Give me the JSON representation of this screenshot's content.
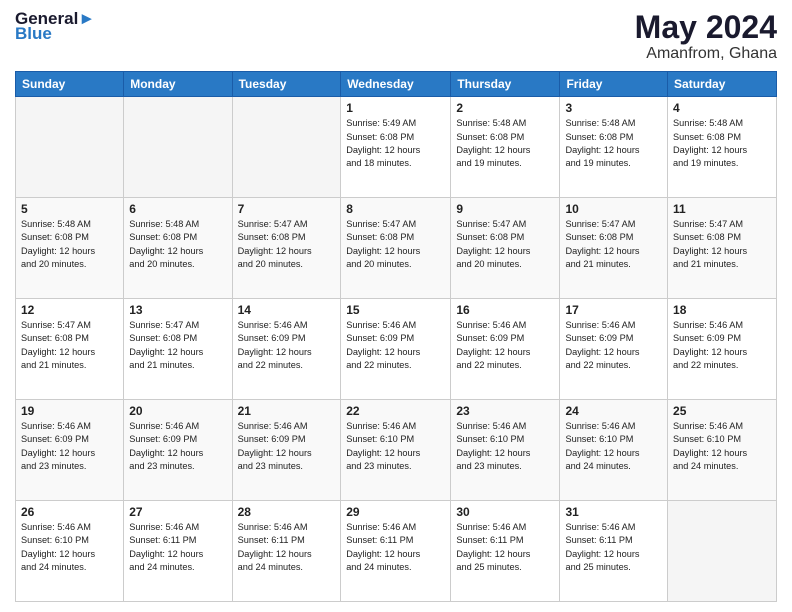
{
  "header": {
    "logo_line1": "General",
    "logo_line2": "Blue",
    "month": "May 2024",
    "location": "Amanfrom, Ghana"
  },
  "weekdays": [
    "Sunday",
    "Monday",
    "Tuesday",
    "Wednesday",
    "Thursday",
    "Friday",
    "Saturday"
  ],
  "weeks": [
    [
      {
        "day": "",
        "info": ""
      },
      {
        "day": "",
        "info": ""
      },
      {
        "day": "",
        "info": ""
      },
      {
        "day": "1",
        "info": "Sunrise: 5:49 AM\nSunset: 6:08 PM\nDaylight: 12 hours\nand 18 minutes."
      },
      {
        "day": "2",
        "info": "Sunrise: 5:48 AM\nSunset: 6:08 PM\nDaylight: 12 hours\nand 19 minutes."
      },
      {
        "day": "3",
        "info": "Sunrise: 5:48 AM\nSunset: 6:08 PM\nDaylight: 12 hours\nand 19 minutes."
      },
      {
        "day": "4",
        "info": "Sunrise: 5:48 AM\nSunset: 6:08 PM\nDaylight: 12 hours\nand 19 minutes."
      }
    ],
    [
      {
        "day": "5",
        "info": "Sunrise: 5:48 AM\nSunset: 6:08 PM\nDaylight: 12 hours\nand 20 minutes."
      },
      {
        "day": "6",
        "info": "Sunrise: 5:48 AM\nSunset: 6:08 PM\nDaylight: 12 hours\nand 20 minutes."
      },
      {
        "day": "7",
        "info": "Sunrise: 5:47 AM\nSunset: 6:08 PM\nDaylight: 12 hours\nand 20 minutes."
      },
      {
        "day": "8",
        "info": "Sunrise: 5:47 AM\nSunset: 6:08 PM\nDaylight: 12 hours\nand 20 minutes."
      },
      {
        "day": "9",
        "info": "Sunrise: 5:47 AM\nSunset: 6:08 PM\nDaylight: 12 hours\nand 20 minutes."
      },
      {
        "day": "10",
        "info": "Sunrise: 5:47 AM\nSunset: 6:08 PM\nDaylight: 12 hours\nand 21 minutes."
      },
      {
        "day": "11",
        "info": "Sunrise: 5:47 AM\nSunset: 6:08 PM\nDaylight: 12 hours\nand 21 minutes."
      }
    ],
    [
      {
        "day": "12",
        "info": "Sunrise: 5:47 AM\nSunset: 6:08 PM\nDaylight: 12 hours\nand 21 minutes."
      },
      {
        "day": "13",
        "info": "Sunrise: 5:47 AM\nSunset: 6:08 PM\nDaylight: 12 hours\nand 21 minutes."
      },
      {
        "day": "14",
        "info": "Sunrise: 5:46 AM\nSunset: 6:09 PM\nDaylight: 12 hours\nand 22 minutes."
      },
      {
        "day": "15",
        "info": "Sunrise: 5:46 AM\nSunset: 6:09 PM\nDaylight: 12 hours\nand 22 minutes."
      },
      {
        "day": "16",
        "info": "Sunrise: 5:46 AM\nSunset: 6:09 PM\nDaylight: 12 hours\nand 22 minutes."
      },
      {
        "day": "17",
        "info": "Sunrise: 5:46 AM\nSunset: 6:09 PM\nDaylight: 12 hours\nand 22 minutes."
      },
      {
        "day": "18",
        "info": "Sunrise: 5:46 AM\nSunset: 6:09 PM\nDaylight: 12 hours\nand 22 minutes."
      }
    ],
    [
      {
        "day": "19",
        "info": "Sunrise: 5:46 AM\nSunset: 6:09 PM\nDaylight: 12 hours\nand 23 minutes."
      },
      {
        "day": "20",
        "info": "Sunrise: 5:46 AM\nSunset: 6:09 PM\nDaylight: 12 hours\nand 23 minutes."
      },
      {
        "day": "21",
        "info": "Sunrise: 5:46 AM\nSunset: 6:09 PM\nDaylight: 12 hours\nand 23 minutes."
      },
      {
        "day": "22",
        "info": "Sunrise: 5:46 AM\nSunset: 6:10 PM\nDaylight: 12 hours\nand 23 minutes."
      },
      {
        "day": "23",
        "info": "Sunrise: 5:46 AM\nSunset: 6:10 PM\nDaylight: 12 hours\nand 23 minutes."
      },
      {
        "day": "24",
        "info": "Sunrise: 5:46 AM\nSunset: 6:10 PM\nDaylight: 12 hours\nand 24 minutes."
      },
      {
        "day": "25",
        "info": "Sunrise: 5:46 AM\nSunset: 6:10 PM\nDaylight: 12 hours\nand 24 minutes."
      }
    ],
    [
      {
        "day": "26",
        "info": "Sunrise: 5:46 AM\nSunset: 6:10 PM\nDaylight: 12 hours\nand 24 minutes."
      },
      {
        "day": "27",
        "info": "Sunrise: 5:46 AM\nSunset: 6:11 PM\nDaylight: 12 hours\nand 24 minutes."
      },
      {
        "day": "28",
        "info": "Sunrise: 5:46 AM\nSunset: 6:11 PM\nDaylight: 12 hours\nand 24 minutes."
      },
      {
        "day": "29",
        "info": "Sunrise: 5:46 AM\nSunset: 6:11 PM\nDaylight: 12 hours\nand 24 minutes."
      },
      {
        "day": "30",
        "info": "Sunrise: 5:46 AM\nSunset: 6:11 PM\nDaylight: 12 hours\nand 25 minutes."
      },
      {
        "day": "31",
        "info": "Sunrise: 5:46 AM\nSunset: 6:11 PM\nDaylight: 12 hours\nand 25 minutes."
      },
      {
        "day": "",
        "info": ""
      }
    ]
  ]
}
